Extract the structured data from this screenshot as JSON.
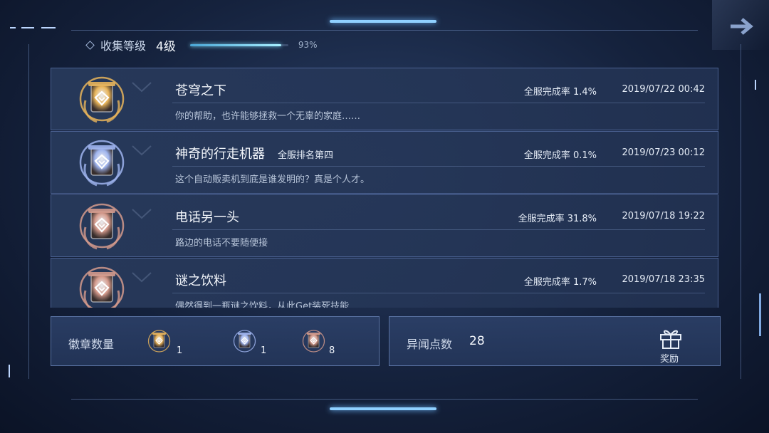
{
  "collection": {
    "label": "收集等级",
    "level": "4级",
    "progress_text": "93%",
    "progress": 0.93
  },
  "achievements": [
    {
      "tier": "gold",
      "title": "苍穹之下",
      "rank": "",
      "desc": "你的帮助，也许能够拯救一个无辜的家庭……",
      "rate": "全服完成率 1.4%",
      "date": "2019/07/22 00:42"
    },
    {
      "tier": "silver",
      "title": "神奇的行走机器",
      "rank": "全服排名第四",
      "desc": "这个自动贩卖机到底是谁发明的？真是个人才。",
      "rate": "全服完成率 0.1%",
      "date": "2019/07/23 00:12"
    },
    {
      "tier": "bronze",
      "title": "电话另一头",
      "rank": "",
      "desc": "路边的电话不要随便接",
      "rate": "全服完成率 31.8%",
      "date": "2019/07/18 19:22"
    },
    {
      "tier": "bronze",
      "title": "谜之饮料",
      "rank": "",
      "desc": "偶然得到一瓶谜之饮料，从此Get装死技能",
      "rate": "全服完成率 1.7%",
      "date": "2019/07/18 23:35"
    }
  ],
  "badge_panel": {
    "label": "徽章数量",
    "gold_count": "1",
    "silver_count": "1",
    "bronze_count": "8"
  },
  "points_panel": {
    "label": "异闻点数",
    "value": "28",
    "reward_label": "奖励"
  },
  "colors": {
    "gold": "#e8b45a",
    "silver": "#9fb4ee",
    "bronze": "#d49a8c",
    "accent": "#8fd0ff"
  },
  "icons": {
    "nav": "forward-arrow-icon",
    "reward": "gift-icon",
    "badge": "badge-icon"
  }
}
